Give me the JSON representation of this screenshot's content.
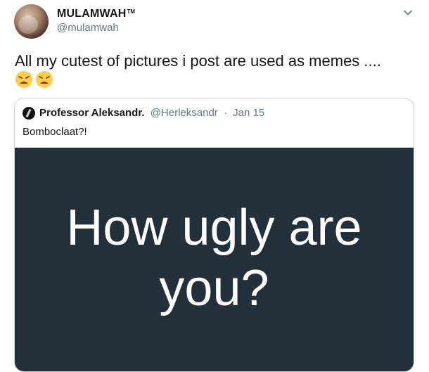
{
  "tweet": {
    "display_name": "MULAMWAH",
    "tm_mark": "TM",
    "handle": "@mulamwah",
    "text": "All my cutest of pictures i post are used as memes ....",
    "emojis": [
      "weary-face-emoji",
      "weary-face-emoji"
    ]
  },
  "quoted_tweet": {
    "display_name": "Professor Aleksandr.",
    "handle": "@Herleksandr",
    "separator": "·",
    "date": "Jan 15",
    "text": "Bomboclaat?!",
    "image_text": "How ugly are you?",
    "image_background": "#233039"
  },
  "colors": {
    "text_primary": "#14171a",
    "text_secondary": "#657786",
    "border": "#ccd6dd"
  }
}
